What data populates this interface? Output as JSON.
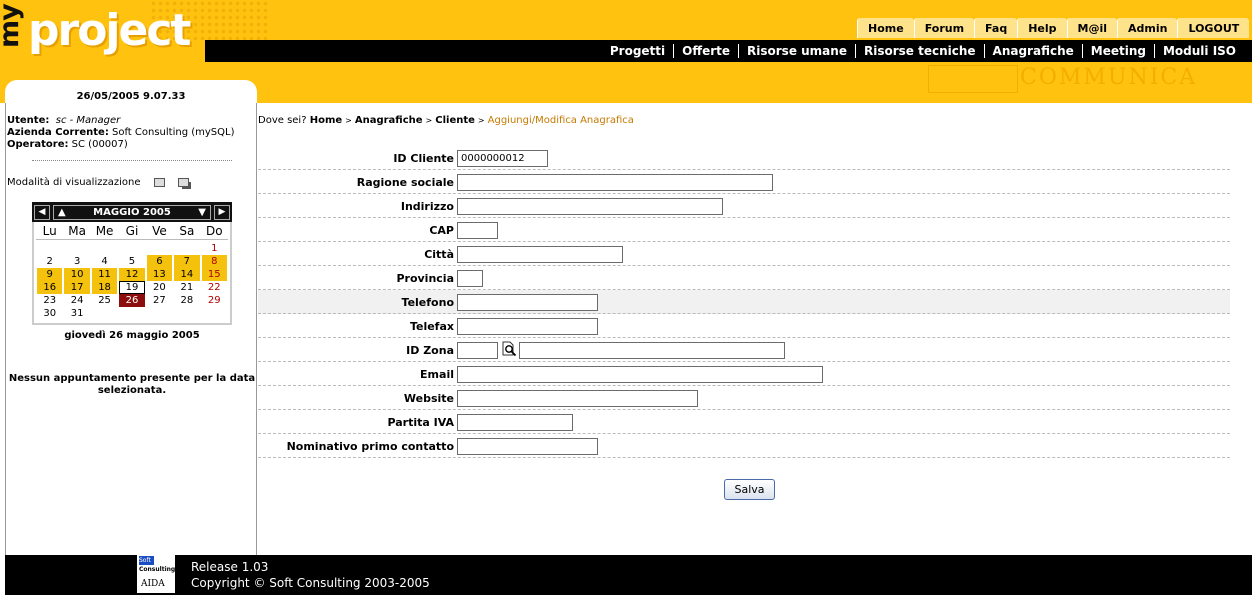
{
  "logo": {
    "my": "my",
    "project": "project"
  },
  "top_nav": [
    "Home",
    "Forum",
    "Faq",
    "Help",
    "M@il",
    "Admin",
    "LOGOUT"
  ],
  "main_nav": [
    "Progetti",
    "Offerte",
    "Risorse umane",
    "Risorse tecniche",
    "Anagrafiche",
    "Meeting",
    "Moduli ISO"
  ],
  "banner_text": "COMMUNICA",
  "sidebar": {
    "datetime": "26/05/2005 9.07.33",
    "user_label": "Utente:",
    "user_value": "sc - Manager",
    "company_label": "Azienda Corrente:",
    "company_value": "Soft Consulting (mySQL)",
    "operator_label": "Operatore:",
    "operator_value": "SC (00007)",
    "view_mode_label": "Modalità di visualizzazione",
    "calendar": {
      "month_label": "MAGGIO 2005",
      "weekdays": [
        "Lu",
        "Ma",
        "Me",
        "Gi",
        "Ve",
        "Sa",
        "Do"
      ],
      "weeks": [
        [
          "",
          "",
          "",
          "",
          "",
          "",
          "1"
        ],
        [
          "2",
          "3",
          "4",
          "5",
          "6",
          "7",
          "8"
        ],
        [
          "9",
          "10",
          "11",
          "12",
          "13",
          "14",
          "15"
        ],
        [
          "16",
          "17",
          "18",
          "19",
          "20",
          "21",
          "22"
        ],
        [
          "23",
          "24",
          "25",
          "26",
          "27",
          "28",
          "29"
        ],
        [
          "30",
          "31",
          "",
          "",
          "",
          "",
          ""
        ]
      ],
      "event_days": [
        "6",
        "7",
        "8",
        "9",
        "10",
        "11",
        "12",
        "13",
        "14",
        "15",
        "16",
        "17",
        "18"
      ],
      "today": "19",
      "selected": "26",
      "selected_date_text": "giovedì 26 maggio 2005"
    },
    "no_appointments": "Nessun appuntamento presente per la data selezionata."
  },
  "breadcrumb": {
    "prefix": "Dove sei?",
    "items": [
      "Home",
      "Anagrafiche",
      "Cliente"
    ],
    "current": "Aggiungi/Modifica Anagrafica"
  },
  "form": {
    "fields": [
      {
        "label": "ID Cliente",
        "value": "0000000012"
      },
      {
        "label": "Ragione sociale",
        "value": ""
      },
      {
        "label": "Indirizzo",
        "value": ""
      },
      {
        "label": "CAP",
        "value": ""
      },
      {
        "label": "Città",
        "value": ""
      },
      {
        "label": "Provincia",
        "value": ""
      },
      {
        "label": "Telefono",
        "value": ""
      },
      {
        "label": "Telefax",
        "value": ""
      },
      {
        "label": "ID Zona",
        "value": "",
        "desc_value": ""
      },
      {
        "label": "Email",
        "value": ""
      },
      {
        "label": "Website",
        "value": ""
      },
      {
        "label": "Partita IVA",
        "value": ""
      },
      {
        "label": "Nominativo primo contatto",
        "value": ""
      }
    ],
    "save_label": "Salva"
  },
  "footer": {
    "logo_top": "Soft",
    "logo_mid": "Consulting",
    "logo_brand": "AIDA",
    "release": "Release 1.03",
    "copyright": "Copyright © Soft Consulting 2003-2005"
  },
  "colors": {
    "header": "#ffc20e",
    "nav_bg": "#000000",
    "breadcrumb_current": "#c57a00",
    "selected_day": "#8b0d0d",
    "event_day": "#f4c20d"
  }
}
